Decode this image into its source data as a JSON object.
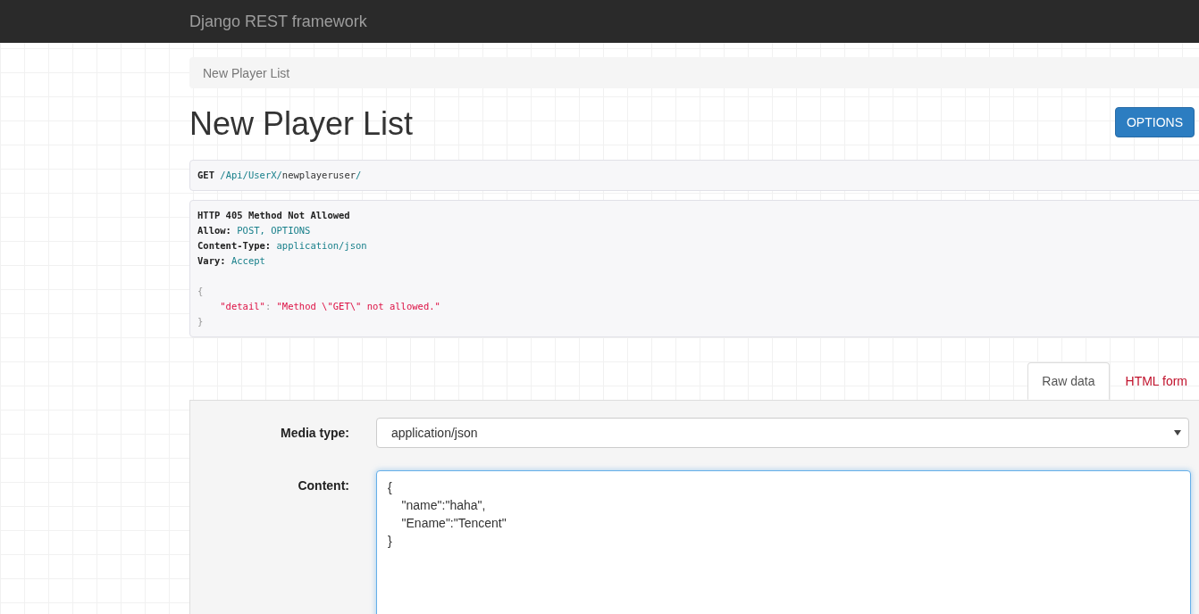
{
  "navbar": {
    "brand": "Django REST framework"
  },
  "breadcrumb": [
    {
      "label": "New Player List",
      "selected": true
    }
  ],
  "title": "New Player List",
  "options_button": "OPTIONS",
  "request": {
    "method": "GET",
    "path": "/Api/UserX/newplayeruser/"
  },
  "response": {
    "status_line": "HTTP 405 Method Not Allowed",
    "headers": [
      {
        "name": "Allow:",
        "value": "POST, OPTIONS"
      },
      {
        "name": "Content-Type:",
        "value": "application/json"
      },
      {
        "name": "Vary:",
        "value": "Accept"
      }
    ],
    "body": {
      "open": "{",
      "key": "\"detail\"",
      "separator": ":",
      "value": "\"Method \\\"GET\\\" not allowed.\"",
      "close": "}"
    }
  },
  "tabs": [
    {
      "label": "Raw data",
      "selected": true
    },
    {
      "label": "HTML form",
      "selected": false
    }
  ],
  "form": {
    "media_type": {
      "label": "Media type:",
      "value": "application/json"
    },
    "content": {
      "label": "Content:",
      "lines": [
        "{",
        "\t\"name\":\"haha\",",
        "\t\"Ename\":\"Tencent\"",
        "}"
      ]
    }
  }
}
